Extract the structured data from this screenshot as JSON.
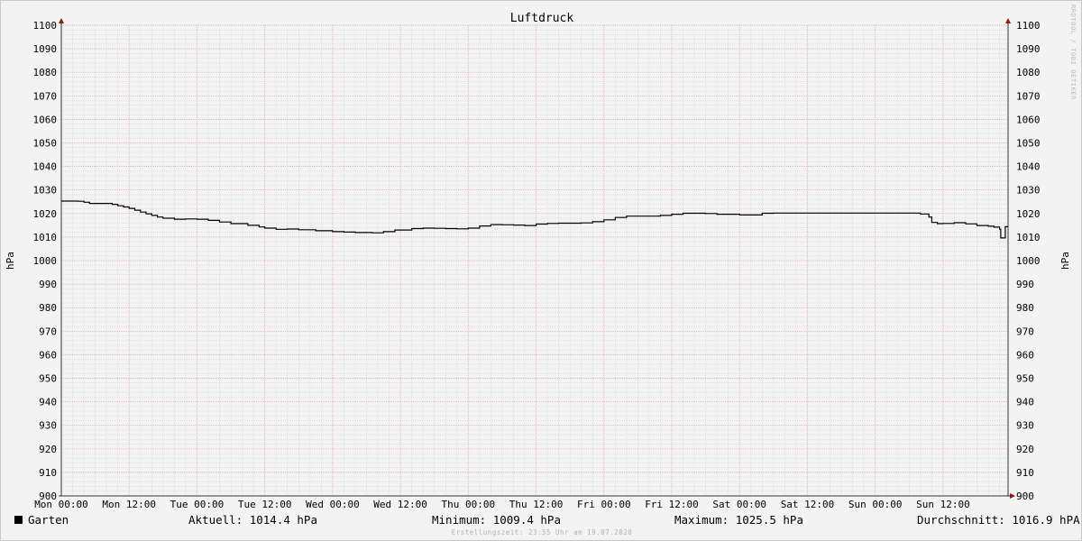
{
  "chart_data": {
    "type": "line",
    "title": "Luftdruck",
    "ylabel": "hPa",
    "ylim": [
      900,
      1100
    ],
    "y_ticks": [
      900,
      910,
      920,
      930,
      940,
      950,
      960,
      970,
      980,
      990,
      1000,
      1010,
      1020,
      1030,
      1040,
      1050,
      1060,
      1070,
      1080,
      1090,
      1100
    ],
    "x_tick_labels": [
      "Mon 00:00",
      "Mon 12:00",
      "Tue 00:00",
      "Tue 12:00",
      "Wed 00:00",
      "Wed 12:00",
      "Thu 00:00",
      "Thu 12:00",
      "Fri 00:00",
      "Fri 12:00",
      "Sat 00:00",
      "Sat 12:00",
      "Sun 00:00",
      "Sun 12:00"
    ],
    "xlim_hours": [
      0,
      167.5
    ],
    "grid": true,
    "legend_position": "bottom-left",
    "series": [
      {
        "name": "Garten",
        "color": "#000000",
        "x_hours": [
          0,
          3,
          4,
          5,
          8,
          9,
          10,
          11,
          12,
          13,
          14,
          15,
          16,
          17,
          18,
          20,
          22,
          24,
          26,
          28,
          30,
          33,
          35,
          36,
          38,
          40,
          42,
          45,
          48,
          50,
          52,
          55,
          57,
          59,
          62,
          64,
          66,
          68,
          70,
          72,
          74,
          76,
          78,
          80,
          82,
          84,
          86,
          88,
          90,
          92,
          94,
          96,
          98,
          100,
          102,
          104,
          106,
          108,
          110,
          112,
          114,
          116,
          120,
          124,
          126,
          128,
          130,
          132,
          138,
          144,
          150,
          152,
          153.5,
          154,
          155,
          156,
          158,
          160,
          162,
          164,
          165,
          166,
          166.2,
          167
        ],
        "values": [
          1025.3,
          1025.2,
          1024.8,
          1024.3,
          1024.3,
          1023.9,
          1023.3,
          1022.8,
          1022.2,
          1021.4,
          1020.6,
          1019.9,
          1019.2,
          1018.5,
          1018.0,
          1017.6,
          1017.7,
          1017.6,
          1017.1,
          1016.4,
          1015.7,
          1015.0,
          1014.3,
          1013.8,
          1013.3,
          1013.4,
          1013.1,
          1012.7,
          1012.3,
          1012.1,
          1011.9,
          1011.8,
          1012.3,
          1013.0,
          1013.6,
          1013.8,
          1013.7,
          1013.6,
          1013.5,
          1013.8,
          1014.7,
          1015.3,
          1015.2,
          1015.1,
          1014.9,
          1015.5,
          1015.8,
          1015.9,
          1015.9,
          1016.0,
          1016.5,
          1017.3,
          1018.3,
          1018.9,
          1018.9,
          1018.9,
          1019.2,
          1019.7,
          1020.1,
          1020.1,
          1020.0,
          1019.7,
          1019.4,
          1020.1,
          1020.2,
          1020.2,
          1020.2,
          1020.2,
          1020.2,
          1020.2,
          1020.2,
          1019.8,
          1018.5,
          1016.2,
          1015.7,
          1015.8,
          1016.1,
          1015.6,
          1014.9,
          1014.6,
          1014.2,
          1013.3,
          1009.6,
          1014.4
        ]
      }
    ]
  },
  "legend": {
    "series_label": "Garten",
    "current": "Aktuell: 1014.4 hPa",
    "minimum": "Minimum: 1009.4 hPa",
    "maximum": "Maximum: 1025.5 hPa",
    "average": "Durchschnitt: 1016.9 hPA"
  },
  "watermark": "RRDTOOL / TOBI OETIKER",
  "footer": "Erstellungszeit: 23:55 Uhr am 19.07.2020"
}
